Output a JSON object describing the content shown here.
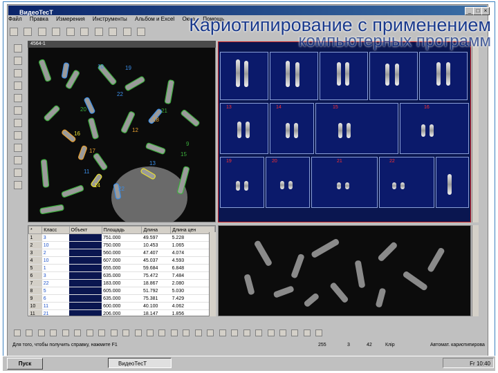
{
  "slide": {
    "title_line1": "Кариотипирование с применением",
    "title_line2": "компьютерных программ"
  },
  "app": {
    "window_title": "ВидеоТесТ",
    "menu": [
      "Файл",
      "Правка",
      "Измерения",
      "Инструменты",
      "Альбом и Excel",
      "Окна",
      "Помощь"
    ],
    "minimize": "_",
    "maximize": "□",
    "close": "×"
  },
  "metaphase_pane": {
    "title": "4564-1",
    "labels": [
      "19",
      "10",
      "22",
      "17",
      "12",
      "21",
      "18",
      "16",
      "20",
      "14",
      "11",
      "15",
      "9",
      "22",
      "13"
    ]
  },
  "karyogram": {
    "group_numbers": [
      "13",
      "14",
      "15",
      "16",
      "19",
      "20",
      "21",
      "22"
    ]
  },
  "table": {
    "headers": [
      "*",
      "Класс",
      "Объект",
      "Площадь",
      "Длина",
      "Длина цен"
    ],
    "rows": [
      {
        "n": "1",
        "cls": "3",
        "area": "751.000",
        "len": "49.597",
        "cen": "5.228"
      },
      {
        "n": "2",
        "cls": "10",
        "area": "750.000",
        "len": "10.453",
        "cen": "1.065"
      },
      {
        "n": "3",
        "cls": "2",
        "area": "560.000",
        "len": "47.407",
        "cen": "4.074"
      },
      {
        "n": "4",
        "cls": "10",
        "area": "607.000",
        "len": "45.037",
        "cen": "4.593"
      },
      {
        "n": "5",
        "cls": "1",
        "area": "655.000",
        "len": "59.684",
        "cen": "6.848"
      },
      {
        "n": "6",
        "cls": "3",
        "area": "635.000",
        "len": "75.472",
        "cen": "7.484"
      },
      {
        "n": "7",
        "cls": "22",
        "area": "183.000",
        "len": "18.867",
        "cen": "2.080"
      },
      {
        "n": "8",
        "cls": "5",
        "area": "605.000",
        "len": "51.792",
        "cen": "5.030"
      },
      {
        "n": "9",
        "cls": "6",
        "area": "635.000",
        "len": "75.381",
        "cen": "7.429"
      },
      {
        "n": "10",
        "cls": "11",
        "area": "600.000",
        "len": "40.100",
        "cen": "4.062"
      },
      {
        "n": "11",
        "cls": "21",
        "area": "206.000",
        "len": "18.147",
        "cen": "1.856"
      }
    ]
  },
  "status": {
    "hint": "Для того, чтобы получить справку, нажмите F1",
    "v1": "255",
    "v2": "3",
    "v3": "42",
    "v4": "Клір",
    "mode": "Автомат. кариотипирова"
  },
  "taskbar": {
    "start": "Пуск",
    "task": "ВидеоТесТ",
    "lang": "Fr",
    "clock": "10:40"
  },
  "colors": {
    "accent": "#0a246a",
    "karyogram_bg": "#0a1650",
    "group_number": "#ff3030",
    "slide_title": "#1a3a8c"
  }
}
